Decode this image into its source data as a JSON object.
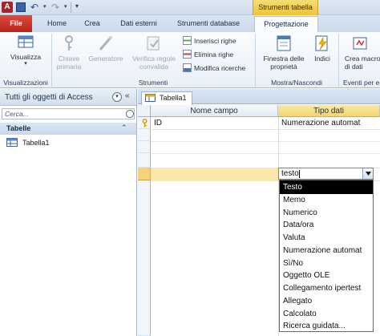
{
  "context_tab": {
    "label": "Strumenti tabella"
  },
  "tabs": [
    {
      "label": "File"
    },
    {
      "label": "Home"
    },
    {
      "label": "Crea"
    },
    {
      "label": "Dati esterni"
    },
    {
      "label": "Strumenti database"
    },
    {
      "label": "Progettazione"
    }
  ],
  "ribbon": {
    "visualizza": "Visualizza",
    "chiave_primaria": "Chiave primaria",
    "generatore": "Generatore",
    "verifica": "Verifica regole convalida",
    "inserisci": "Inserisci righe",
    "elimina": "Elimina righe",
    "modifica": "Modifica ricerche",
    "finestra": "Finestra delle proprietà",
    "indici": "Indici",
    "crea_macro": "Crea macro di dati",
    "groups": {
      "visualizzazioni": "Visualizzazioni",
      "strumenti": "Strumenti",
      "mostra": "Mostra/Nascondi",
      "eventi": "Eventi per e"
    }
  },
  "nav": {
    "title": "Tutti gli oggetti di Access",
    "search_placeholder": "Cerca...",
    "group": "Tabelle",
    "item": "Tabella1"
  },
  "document": {
    "tab": "Tabella1",
    "columns": [
      "Nome campo",
      "Tipo dati"
    ],
    "rows": [
      {
        "field": "ID",
        "type": "Numerazione automat"
      }
    ],
    "combo_value": "testo"
  },
  "dropdown": {
    "options": [
      "Testo",
      "Memo",
      "Numerico",
      "Data/ora",
      "Valuta",
      "Numerazione automat",
      "Sì/No",
      "Oggetto OLE",
      "Collegamento ipertest",
      "Allegato",
      "Calcolato",
      "Ricerca guidata..."
    ],
    "selected": "Testo"
  },
  "colors": {
    "file_tab": "#c8322a",
    "context_tab": "#f0c94a",
    "accent": "#1f4e8c"
  }
}
